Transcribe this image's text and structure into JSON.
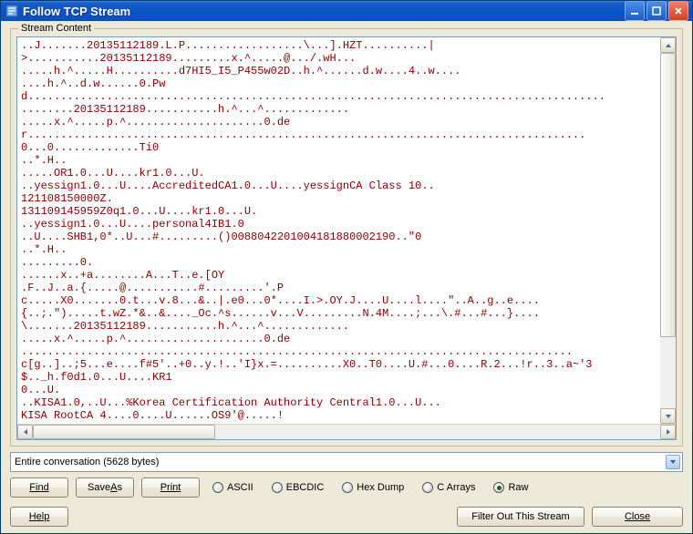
{
  "window": {
    "title": "Follow TCP Stream"
  },
  "group": {
    "label": "Stream Content"
  },
  "stream": {
    "lines": [
      "..J.......20135112189.L.P..................\\...].HZT..........|",
      ">...........20135112189.........x.^.....@.../.wH...",
      ".....h.^.....H..........d7HI5_I5_P455w02D..h.^......d.w....4..w....",
      "....h.^..d.w......0.Pw",
      "d........................................................................................",
      "........20135112189...........h.^...^.............",
      ".....x.^.....p.^.....................0.de",
      "r.....................................................................................",
      "0...0.............Ti0",
      "..*.H..",
      ".....OR1.0...U....kr1.0...U.",
      "..yessign1.0...U....AccreditedCA1.0...U....yessignCA Class 10..",
      "121108150000Z.",
      "131109145959Z0q1.0...U....kr1.0...U.",
      "..yessign1.0...U....personal4IB1.0",
      "..U....SHB1,0*..U...#.........()0088042201004181880002190..\"0",
      "..*.H..",
      ".........0.",
      "......x..+a........A...T..e.[OY",
      ".F..J..a.{.....@...........#.........'.P",
      "c.....X0.......0.t...v.8...&..|.e0...0*....I.>.OY.J....U....l....\"..A..g..e....",
      "{..;.\").....t.wZ.*&..&...._Oc.^s......v...V.........N.4M....;...\\.#...#...}....",
      "\\.......20135112189...........h.^...^.............",
      ".....x.^.....p.^.....................0.de",
      "....................................................................................",
      "c[g..]..;5...e....f#5'..+0..y.!..'I}x.=..........X0..T0....U.#...0....R.2...!r..3..a~'3",
      "$.._h.f0d1.0...U....KR1",
      "0...U.",
      "..KISA1.0,..U...%Korea Certification Authority Central1.0...U...",
      "KISA RootCA 4....0....U......OS9'@.....!"
    ]
  },
  "dropdown": {
    "text": "Entire conversation (5628 bytes)"
  },
  "buttons": {
    "find": "Find",
    "saveas_prefix": "Save ",
    "saveas_u": "A",
    "saveas_suffix": "s",
    "print": "Print",
    "help": "Help",
    "filter": "Filter Out This Stream",
    "close": "Close"
  },
  "radios": {
    "ascii": "ASCII",
    "ebcdic": "EBCDIC",
    "hexdump": "Hex Dump",
    "carrays": "C Arrays",
    "raw": "Raw"
  }
}
